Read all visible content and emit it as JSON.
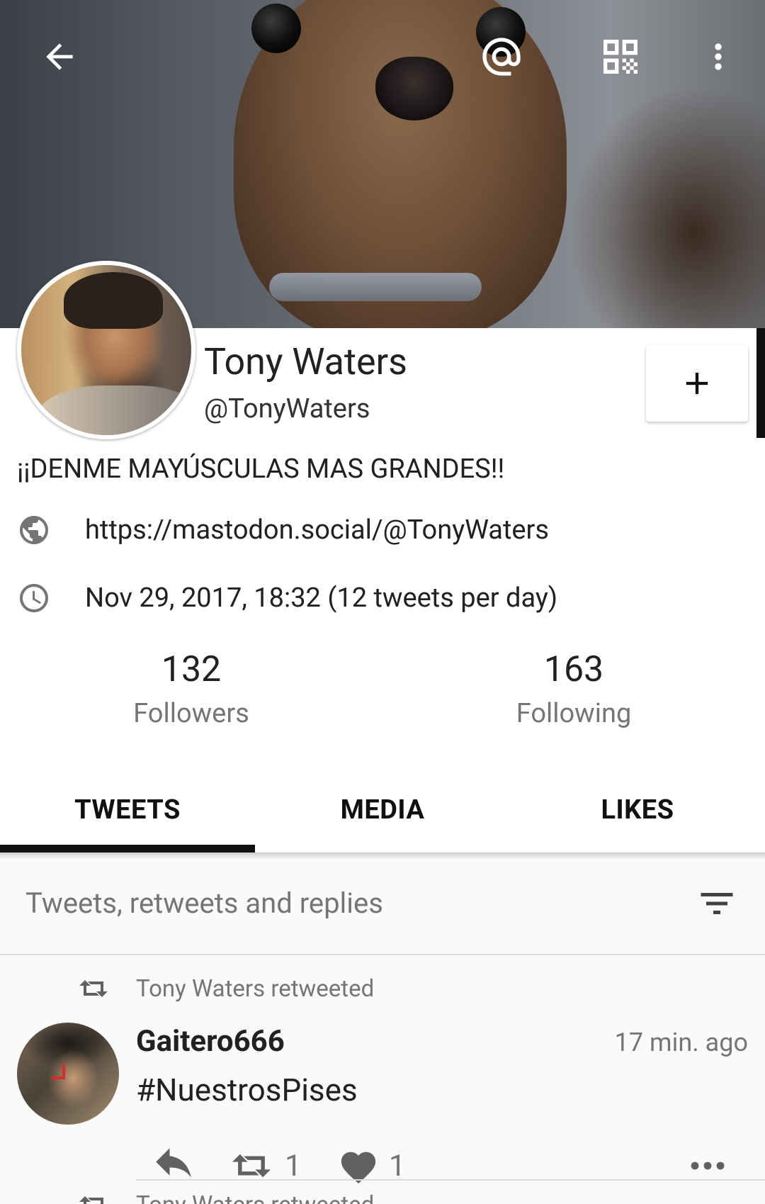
{
  "toolbar": {
    "back_icon": "arrow-left-icon",
    "mention_icon": "at-sign-icon",
    "qr_icon": "qr-code-icon",
    "more_icon": "more-vert-icon"
  },
  "profile": {
    "display_name": "Tony Waters",
    "username": "@TonyWaters",
    "follow_button_label": "+",
    "bio": "¡¡DENME MAYÚSCULAS MAS GRANDES!!",
    "website": "https://mastodon.social/@TonyWaters",
    "joined": "Nov 29, 2017, 18:32 (12 tweets per day)"
  },
  "stats": {
    "followers_count": "132",
    "followers_label": "Followers",
    "following_count": "163",
    "following_label": "Following"
  },
  "tabs": [
    {
      "label": "TWEETS",
      "active": true
    },
    {
      "label": "MEDIA",
      "active": false
    },
    {
      "label": "LIKES",
      "active": false
    }
  ],
  "filter": {
    "label": "Tweets, retweets and replies",
    "icon": "filter-list-icon"
  },
  "statuses": [
    {
      "retweet_text": "Tony Waters retweeted",
      "author": "Gaitero666",
      "time": "17 min. ago",
      "content": "#NuestrosPises",
      "retweet_count": "1",
      "like_count": "1"
    }
  ],
  "next_status": {
    "retweet_text": "Tony Waters retweeted"
  },
  "colors": {
    "text_primary": "#212121",
    "text_secondary": "#757575",
    "tab_indicator": "#111111",
    "timeline_bg": "#fafafa"
  }
}
